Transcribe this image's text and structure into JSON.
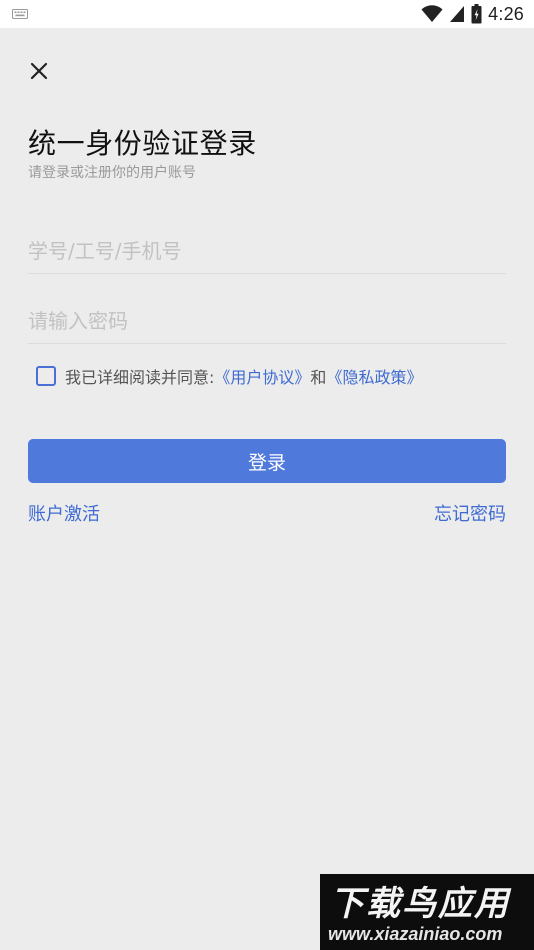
{
  "status_bar": {
    "time": "4:26",
    "icons": [
      "keyboard-icon",
      "wifi-icon",
      "cellular-signal-icon",
      "battery-icon"
    ]
  },
  "login": {
    "close_icon": "close-icon",
    "title": "统一身份验证登录",
    "subtitle": "请登录或注册你的用户账号",
    "account_field": {
      "value": "",
      "placeholder": "学号/工号/手机号"
    },
    "password_field": {
      "value": "",
      "placeholder": "请输入密码"
    },
    "agreement": {
      "checked": false,
      "prefix": "我已详细阅读并同意:",
      "user_agreement": "《用户协议》",
      "and": "和",
      "privacy_policy": "《隐私政策》"
    },
    "login_button": "登录",
    "activate_account": "账户激活",
    "forgot_password": "忘记密码"
  },
  "watermark": {
    "title": "下载鸟应用",
    "url": "www.xiazainiao.com"
  },
  "colors": {
    "background": "#ececec",
    "accent": "#5079dc",
    "link": "#3f6bd2",
    "placeholder": "#c2c2c2"
  }
}
